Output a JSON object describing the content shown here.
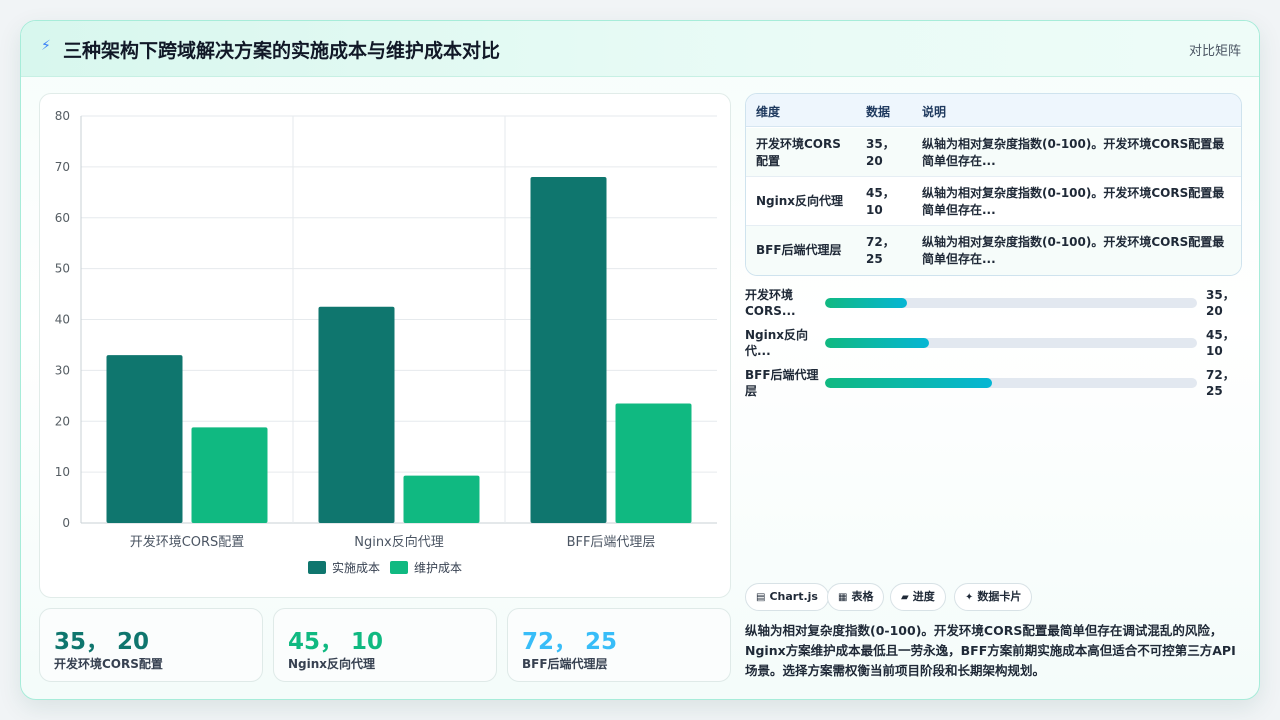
{
  "header": {
    "title": "三种架构下跨域解决方案的实施成本与维护成本对比",
    "tag": "对比矩阵"
  },
  "colors": {
    "series_impl": "#0f766e",
    "series_maint": "#10b981",
    "stat_1": "#0f766e",
    "stat_2": "#10b981",
    "stat_3": "#38bdf8"
  },
  "chart_data": {
    "type": "bar",
    "categories": [
      "开发环境CORS配置",
      "Nginx反向代理",
      "BFF后端代理层"
    ],
    "series": [
      {
        "name": "实施成本",
        "values": [
          33,
          42.5,
          68
        ]
      },
      {
        "name": "维护成本",
        "values": [
          18.8,
          9.3,
          23.5
        ]
      }
    ],
    "yticks": [
      "0",
      "10",
      "20",
      "30",
      "40",
      "50",
      "60",
      "70",
      "80"
    ],
    "ylim": [
      0,
      80
    ],
    "grid": true,
    "legend": "bottom"
  },
  "stats": [
    {
      "value": "35， 20",
      "label": "开发环境CORS配置"
    },
    {
      "value": "45， 10",
      "label": "Nginx反向代理"
    },
    {
      "value": "72， 25",
      "label": "BFF后端代理层"
    }
  ],
  "table": {
    "headers": [
      "维度",
      "数据",
      "说明"
    ],
    "rows": [
      {
        "dim": "开发环境CORS配置",
        "data": "35， 20",
        "note": "纵轴为相对复杂度指数(0-100)。开发环境CORS配置最简单但存在..."
      },
      {
        "dim": "Nginx反向代理",
        "data": "45， 10",
        "note": "纵轴为相对复杂度指数(0-100)。开发环境CORS配置最简单但存在..."
      },
      {
        "dim": "BFF后端代理层",
        "data": "72， 25",
        "note": "纵轴为相对复杂度指数(0-100)。开发环境CORS配置最简单但存在..."
      }
    ]
  },
  "progress": [
    {
      "label": "开发环境CORS...",
      "value": "35， 20",
      "fraction": 0.22
    },
    {
      "label": "Nginx反向代...",
      "value": "45， 10",
      "fraction": 0.28
    },
    {
      "label": "BFF后端代理层",
      "value": "72， 25",
      "fraction": 0.45
    }
  ],
  "chips": [
    {
      "icon": "chart-icon",
      "glyph": "▤",
      "label": "Chart.js"
    },
    {
      "icon": "table-icon",
      "glyph": "▦",
      "label": "表格"
    },
    {
      "icon": "progress-icon",
      "glyph": "▰",
      "label": "进度"
    },
    {
      "icon": "sparkle-icon",
      "glyph": "✦",
      "label": "数据卡片"
    }
  ],
  "summary": "纵轴为相对复杂度指数(0-100)。开发环境CORS配置最简单但存在调试混乱的风险，Nginx方案维护成本最低且一劳永逸，BFF方案前期实施成本高但适合不可控第三方API场景。选择方案需权衡当前项目阶段和长期架构规划。"
}
